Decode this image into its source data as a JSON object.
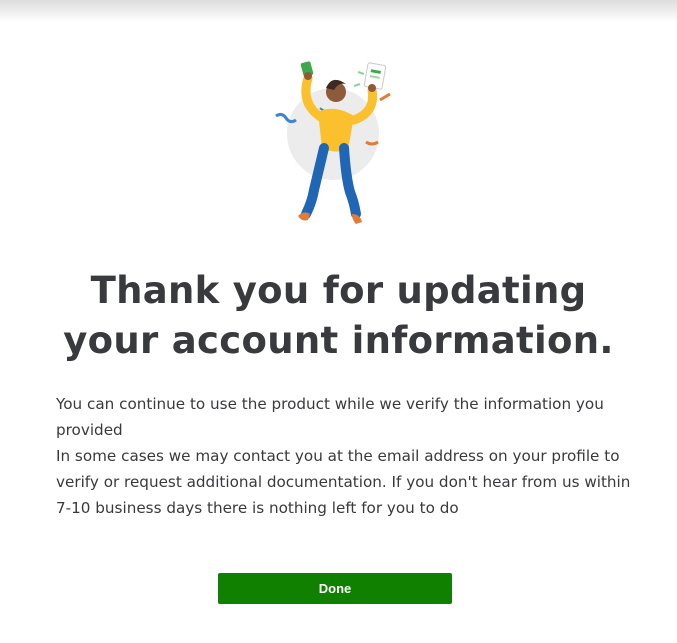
{
  "heading": {
    "line1": "Thank you for updating",
    "line2": "your account information."
  },
  "body": {
    "paragraph1": "You can continue to use the product while we verify the information you provided",
    "paragraph2": "In some cases we may contact you at the email address on your profile to verify or request additional documentation. If you don't hear from us within 7-10 business days there is nothing left for you to do"
  },
  "actions": {
    "done_label": "Done"
  },
  "colors": {
    "primary_button": "#108000",
    "text": "#393a3d"
  },
  "illustration": {
    "icon": "celebrating-person-icon"
  }
}
